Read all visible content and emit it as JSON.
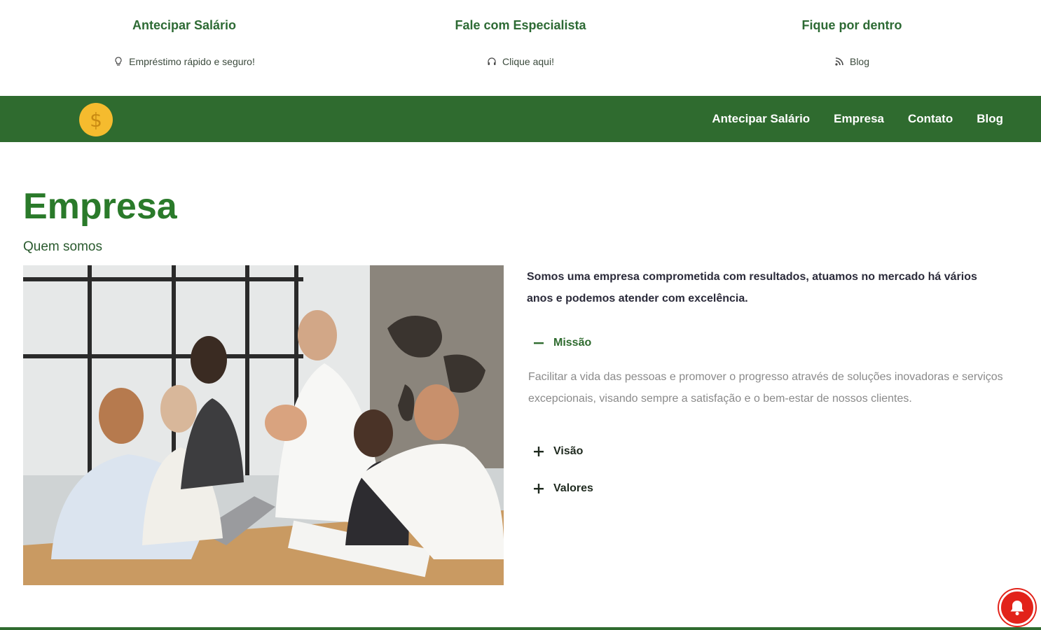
{
  "topbar": {
    "col1": {
      "title": "Antecipar Salário",
      "link": "Empréstimo rápido e seguro!",
      "icon": "lightbulb-icon"
    },
    "col2": {
      "title": "Fale com Especialista",
      "link": "Clique aqui!",
      "icon": "headset-icon"
    },
    "col3": {
      "title": "Fique por dentro",
      "link": "Blog",
      "icon": "rss-icon"
    }
  },
  "navbar": {
    "logo_symbol": "$",
    "links": [
      "Antecipar Salário",
      "Empresa",
      "Contato",
      "Blog"
    ]
  },
  "main": {
    "title": "Empresa",
    "subtitle": "Quem somos",
    "intro": "Somos uma empresa comprometida com resultados, atuamos no mercado há vários anos e podemos atender com excelência.",
    "accordion": {
      "missao_label": "Missão",
      "missao_text": "Facilitar a vida das pessoas e promover o progresso através de soluções inovadoras e serviços excepcionais, visando sempre a satisfação e o bem-estar de nossos clientes.",
      "visao_label": "Visão",
      "valores_label": "Valores"
    }
  },
  "colors": {
    "brand_green": "#2f6b2f",
    "title_green": "#2a7a2a",
    "logo_gold": "#f5bb2e",
    "notification_red": "#e2231a"
  }
}
